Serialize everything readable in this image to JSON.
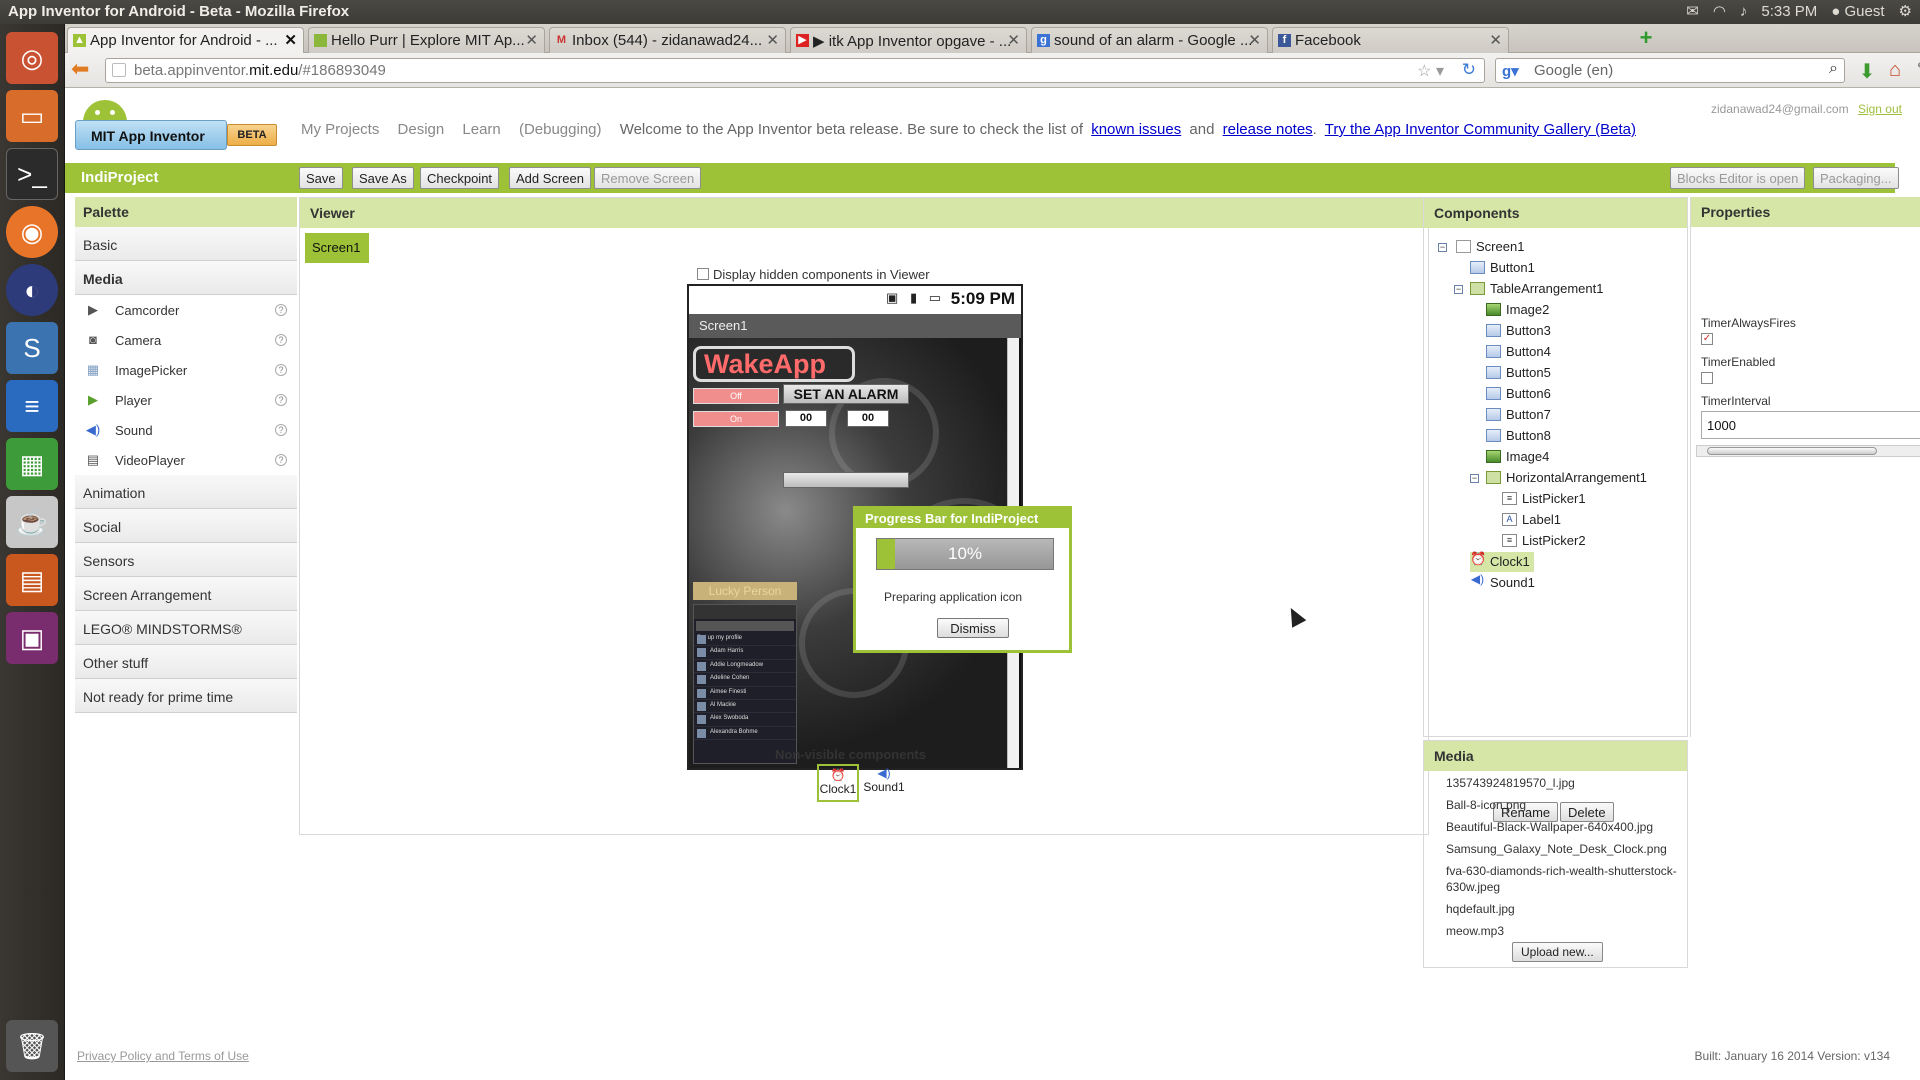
{
  "window": {
    "title": "App Inventor for Android - Beta - Mozilla Firefox"
  },
  "system_tray": {
    "time": "5:33 PM",
    "user": "Guest"
  },
  "tabs": [
    {
      "label": "App Inventor for Android - ...",
      "active": true
    },
    {
      "label": "Hello Purr | Explore MIT Ap...",
      "active": false
    },
    {
      "label": "Inbox (544) - zidanawad24...",
      "active": false
    },
    {
      "label": "▶ itk App Inventor opgave - ...",
      "active": false
    },
    {
      "label": "sound of an alarm - Google ...",
      "active": false
    },
    {
      "label": "Facebook",
      "active": false
    }
  ],
  "address": {
    "prefix": "beta.appinventor.",
    "domain": "mit.edu",
    "suffix": "/#186893049"
  },
  "search": {
    "placeholder": "Google (en)"
  },
  "logo": {
    "name": "MIT App Inventor",
    "badge": "BETA"
  },
  "topnav": {
    "my_projects": "My Projects",
    "design": "Design",
    "learn": "Learn",
    "debugging": "(Debugging)",
    "welcome": "Welcome to the App Inventor beta release. Be sure to check the list of",
    "known_issues": "known issues",
    "and": "and",
    "release_notes": "release notes",
    "community": "Try the App Inventor Community Gallery (Beta)"
  },
  "account": {
    "email": "zidanawad24@gmail.com",
    "signout": "Sign out"
  },
  "toolbar": {
    "project": "IndiProject",
    "save": "Save",
    "save_as": "Save As",
    "checkpoint": "Checkpoint",
    "add_screen": "Add Screen",
    "remove_screen": "Remove Screen",
    "blocks_editor": "Blocks Editor is open",
    "packaging": "Packaging..."
  },
  "palette": {
    "title": "Palette",
    "basic": "Basic",
    "media": "Media",
    "media_items": [
      "Camcorder",
      "Camera",
      "ImagePicker",
      "Player",
      "Sound",
      "VideoPlayer"
    ],
    "help": "?",
    "animation": "Animation",
    "social": "Social",
    "sensors": "Sensors",
    "screen_arrangement": "Screen Arrangement",
    "lego": "LEGO® MINDSTORMS®",
    "other": "Other stuff",
    "not_ready": "Not ready for prime time"
  },
  "viewer": {
    "title": "Viewer",
    "screen_tab": "Screen1",
    "hidden_checkbox": "Display hidden components in Viewer",
    "phone": {
      "time": "5:09 PM",
      "screen_title": "Screen1",
      "app_title": "WakeApp",
      "off": "Off",
      "on": "On",
      "set_alarm": "SET AN ALARM",
      "hour": "00",
      "minute": "00",
      "lucky": "Lucky Person",
      "contacts_header": "Set up my profile",
      "contacts": [
        "Adam Harris",
        "Addie Longmeadow",
        "Adeline Cohen",
        "Aimee Finesti",
        "Al Mackie",
        "Alex Swoboda",
        "Alexandra Bohme"
      ]
    },
    "nonvisible_title": "Non-visible components",
    "nonvisible": [
      "Clock1",
      "Sound1"
    ]
  },
  "progress": {
    "title": "Progress Bar for IndiProject",
    "percent_text": "10%",
    "percent": 10,
    "message": "Preparing application icon",
    "dismiss": "Dismiss"
  },
  "components": {
    "title": "Components",
    "tree": {
      "screen1": "Screen1",
      "button1": "Button1",
      "table": "TableArrangement1",
      "image2": "Image2",
      "button3": "Button3",
      "button4": "Button4",
      "button5": "Button5",
      "button6": "Button6",
      "button7": "Button7",
      "button8": "Button8",
      "image4": "Image4",
      "horiz": "HorizontalArrangement1",
      "listpicker1": "ListPicker1",
      "label1": "Label1",
      "listpicker2": "ListPicker2",
      "clock1": "Clock1",
      "sound1": "Sound1"
    },
    "rename": "Rename",
    "delete": "Delete"
  },
  "media": {
    "title": "Media",
    "files": [
      "135743924819570_l.jpg",
      "Ball-8-icon.png",
      "Beautiful-Black-Wallpaper-640x400.jpg",
      "Samsung_Galaxy_Note_Desk_Clock.png",
      "fva-630-diamonds-rich-wealth-shutterstock-630w.jpeg",
      "hqdefault.jpg",
      "meow.mp3"
    ],
    "upload": "Upload new..."
  },
  "properties": {
    "title": "Properties",
    "timer_always_fires": "TimerAlwaysFires",
    "timer_always_fires_value": true,
    "timer_enabled": "TimerEnabled",
    "timer_enabled_value": false,
    "timer_interval": "TimerInterval",
    "timer_interval_value": "1000"
  },
  "footer": {
    "privacy": "Privacy Policy and Terms of Use",
    "build": "Built: January 16 2014 Version: v134"
  }
}
